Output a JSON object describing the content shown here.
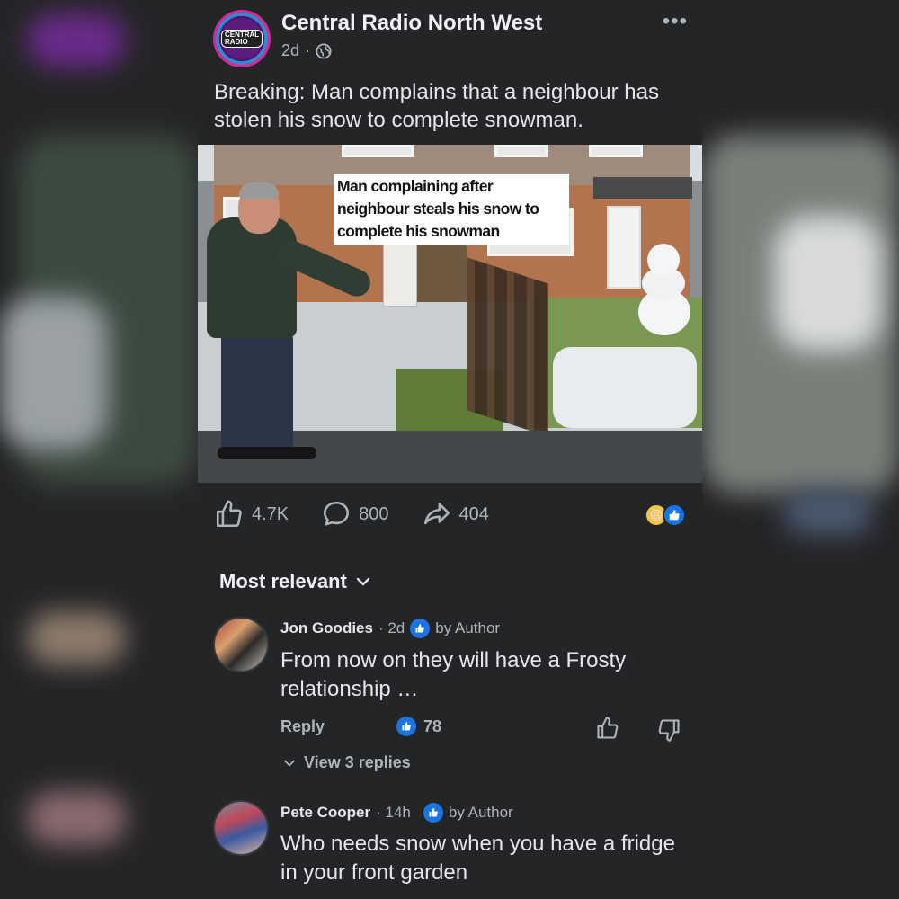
{
  "post": {
    "page_name": "Central Radio North West",
    "time": "2d",
    "visibility_icon": "globe-icon",
    "avatar_text": "CENTRAL RADIO",
    "text": "Breaking: Man complains that a neighbour has stolen his snow to complete snowman.",
    "image_caption": "Man complaining after neighbour steals his snow to complete his snowman",
    "stats": {
      "likes": "4.7K",
      "comments": "800",
      "shares": "404"
    },
    "reactions": [
      "haha-emoji",
      "like-icon"
    ]
  },
  "comments_sort": "Most relevant",
  "comments": [
    {
      "name": "Jon Goodies",
      "time": "· 2d",
      "badge": "by Author",
      "text": "From now on they will have a Frosty relationship …",
      "reply_label": "Reply",
      "likes": "78",
      "view_replies": "View 3 replies"
    },
    {
      "name": "Pete Cooper",
      "time": "· 14h",
      "badge": "by Author",
      "text": "Who needs snow when you have a fridge in your front garden"
    }
  ],
  "colors": {
    "background": "#242526",
    "accent": "#1b74e4",
    "text_primary": "#e4e6eb",
    "text_secondary": "#b0b3b8"
  }
}
